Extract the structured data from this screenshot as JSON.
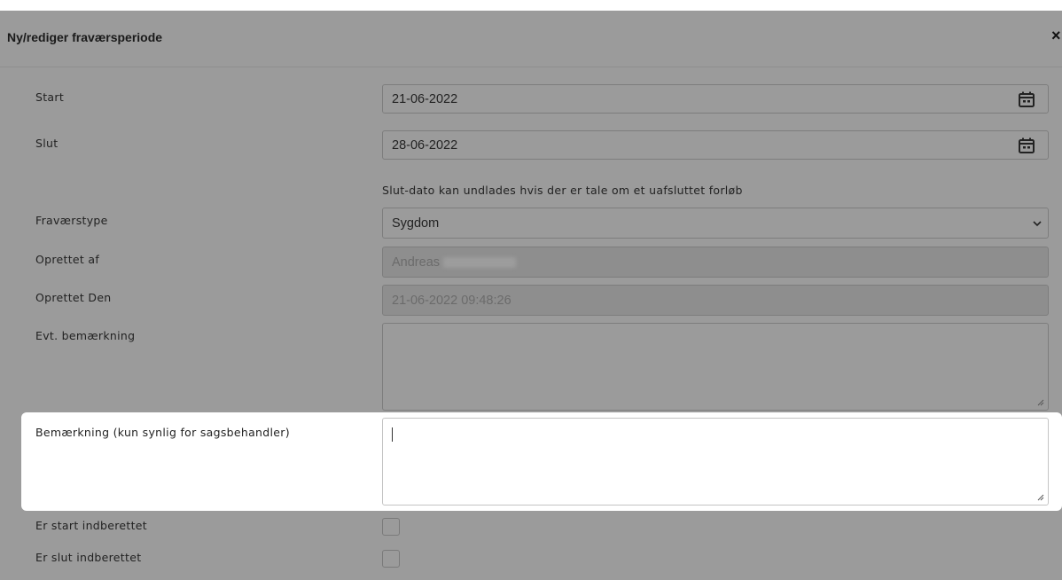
{
  "dialog": {
    "title": "Ny/rediger fraværsperiode",
    "close_label": "×"
  },
  "fields": {
    "start": {
      "label": "Start",
      "value": "21-06-2022",
      "icon": "calendar-icon"
    },
    "slut": {
      "label": "Slut",
      "value": "28-06-2022",
      "icon": "calendar-icon"
    },
    "hint": "Slut-dato kan undlades hvis der er tale om et uafsluttet forløb",
    "fravaerstype": {
      "label": "Fraværstype",
      "value": "Sygdom",
      "icon": "chevron-down-icon"
    },
    "oprettet_af": {
      "label": "Oprettet af",
      "value": "Andreas"
    },
    "oprettet_den": {
      "label": "Oprettet Den",
      "value": "21-06-2022 09:48:26"
    },
    "evt_bemaerkning": {
      "label": "Evt. bemærkning",
      "value": ""
    },
    "bemaerkning_sagsbehandler": {
      "label": "Bemærkning (kun synlig for sagsbehandler)",
      "value": ""
    },
    "er_start_indberettet": {
      "label": "Er start indberettet",
      "checked": false
    },
    "er_slut_indberettet": {
      "label": "Er slut indberettet",
      "checked": false
    }
  }
}
